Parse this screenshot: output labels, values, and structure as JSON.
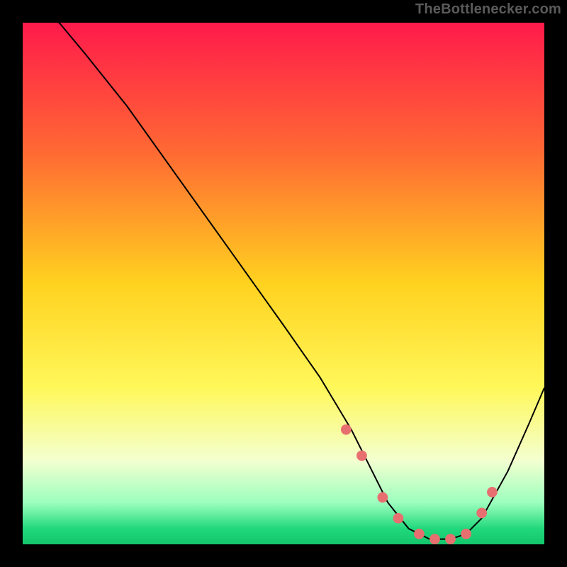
{
  "attribution": "TheBottlenecker.com",
  "chart_data": {
    "type": "line",
    "title": "",
    "xlabel": "",
    "ylabel": "",
    "xlim": [
      0,
      100
    ],
    "ylim": [
      0,
      100
    ],
    "grid": false,
    "background_gradient": {
      "stops": [
        {
          "offset": 0,
          "color": "#ff1a4b"
        },
        {
          "offset": 0.25,
          "color": "#ff6a33"
        },
        {
          "offset": 0.5,
          "color": "#ffd21f"
        },
        {
          "offset": 0.7,
          "color": "#fff85a"
        },
        {
          "offset": 0.84,
          "color": "#f3ffd0"
        },
        {
          "offset": 0.92,
          "color": "#9cffbe"
        },
        {
          "offset": 0.97,
          "color": "#21d87c"
        },
        {
          "offset": 1.0,
          "color": "#13c66c"
        }
      ]
    },
    "series": [
      {
        "name": "bottleneck-curve",
        "color": "#000000",
        "x": [
          0,
          7,
          12,
          20,
          30,
          40,
          50,
          57,
          60,
          63,
          66,
          70,
          74,
          78,
          82,
          85,
          88,
          93,
          97,
          100
        ],
        "y": [
          102,
          100,
          94,
          84,
          70,
          56,
          42,
          32,
          27,
          22,
          16,
          8,
          3,
          1,
          1,
          2,
          5,
          14,
          23,
          30
        ]
      }
    ],
    "markers": {
      "name": "highlight-dots",
      "color": "#e76f6f",
      "x": [
        62,
        65,
        69,
        72,
        76,
        79,
        82,
        85,
        88,
        90
      ],
      "y": [
        22,
        17,
        9,
        5,
        2,
        1,
        1,
        2,
        6,
        10
      ]
    }
  }
}
